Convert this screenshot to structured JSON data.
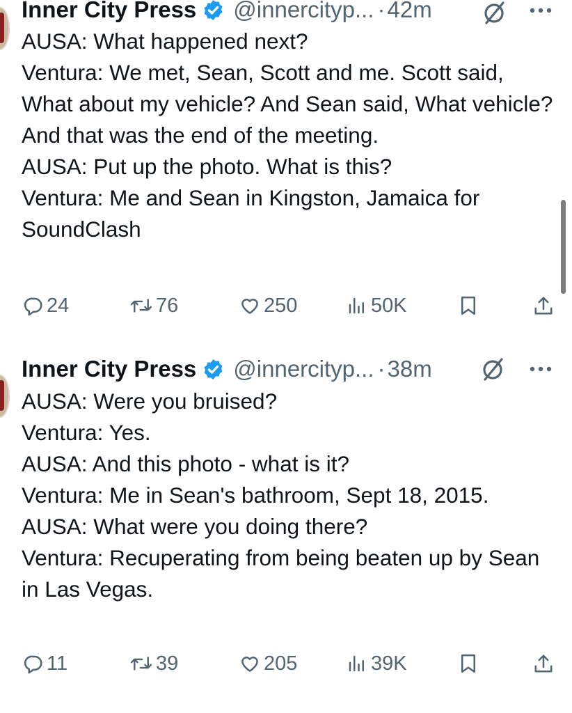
{
  "tweets": [
    {
      "author_name": "Inner City Press",
      "handle": "@innercityp...",
      "separator": "·",
      "time": "42m",
      "text": "AUSA: What happened next?\nVentura: We met, Sean, Scott and me. Scott said, What about my vehicle? And Sean said, What vehicle? And that was the end of the meeting.\nAUSA: Put up the photo. What is this?\nVentura: Me and Sean in Kingston, Jamaica for SoundClash",
      "replies": "24",
      "reposts": "76",
      "likes": "250",
      "views": "50K"
    },
    {
      "author_name": "Inner City Press",
      "handle": "@innercityp...",
      "separator": "·",
      "time": "38m",
      "text": "AUSA: Were you bruised?\nVentura: Yes.\nAUSA: And this photo - what is it?\nVentura: Me in Sean's bathroom, Sept 18, 2015.\nAUSA: What were you doing there?\nVentura: Recuperating from being beaten up by Sean in Las Vegas.",
      "replies": "11",
      "reposts": "39",
      "likes": "205",
      "views": "39K"
    }
  ],
  "colors": {
    "text": "#0f1419",
    "secondary": "#536471",
    "verified": "#1d9bf0"
  },
  "icons": [
    "verified-badge-icon",
    "grok-icon",
    "more-icon",
    "reply-icon",
    "repost-icon",
    "like-icon",
    "views-icon",
    "bookmark-icon",
    "share-icon"
  ]
}
